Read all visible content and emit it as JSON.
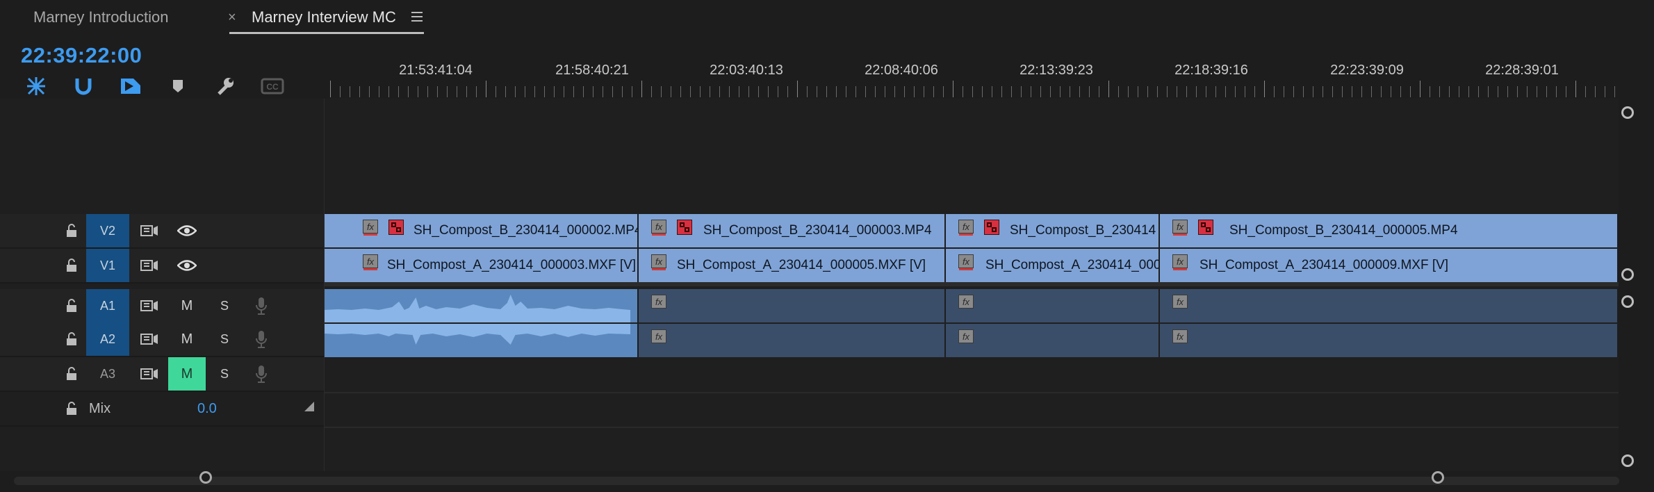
{
  "tabs": [
    {
      "label": "Marney Introduction"
    },
    {
      "label": "Marney Interview MC"
    }
  ],
  "timecode": "22:39:22:00",
  "toolbar": {
    "icons": [
      "snap-icon",
      "linked-selection-icon",
      "insert-overwrite-icon",
      "marker-icon",
      "wrench-icon",
      "captions-icon"
    ]
  },
  "ruler": {
    "labels": [
      "21:53:41:04",
      "21:58:40:21",
      "22:03:40:13",
      "22:08:40:06",
      "22:13:39:23",
      "22:18:39:16",
      "22:23:39:09",
      "22:28:39:01"
    ]
  },
  "tracks": {
    "v2": {
      "label": "V2"
    },
    "v1": {
      "label": "V1"
    },
    "a1": {
      "label": "A1",
      "m": "M",
      "s": "S"
    },
    "a2": {
      "label": "A2",
      "m": "M",
      "s": "S"
    },
    "a3": {
      "label": "A3",
      "m": "M",
      "s": "S"
    },
    "mix": {
      "label": "Mix",
      "value": "0.0"
    }
  },
  "clips": {
    "v2": [
      "SH_Compost_B_230414_000002.MP4",
      "SH_Compost_B_230414_000003.MP4",
      "SH_Compost_B_230414",
      "SH_Compost_B_230414_000005.MP4"
    ],
    "v1": [
      "SH_Compost_A_230414_000003.MXF [V]",
      "SH_Compost_A_230414_000005.MXF [V]",
      "SH_Compost_A_230414_000",
      "SH_Compost_A_230414_000009.MXF [V]"
    ]
  },
  "fx_label": "fx",
  "colors": {
    "accent": "#3d9bf0",
    "mute_on": "#3fd79a",
    "video_clip": "#7fa3d6",
    "audio_clip": "#3a4e6a"
  }
}
